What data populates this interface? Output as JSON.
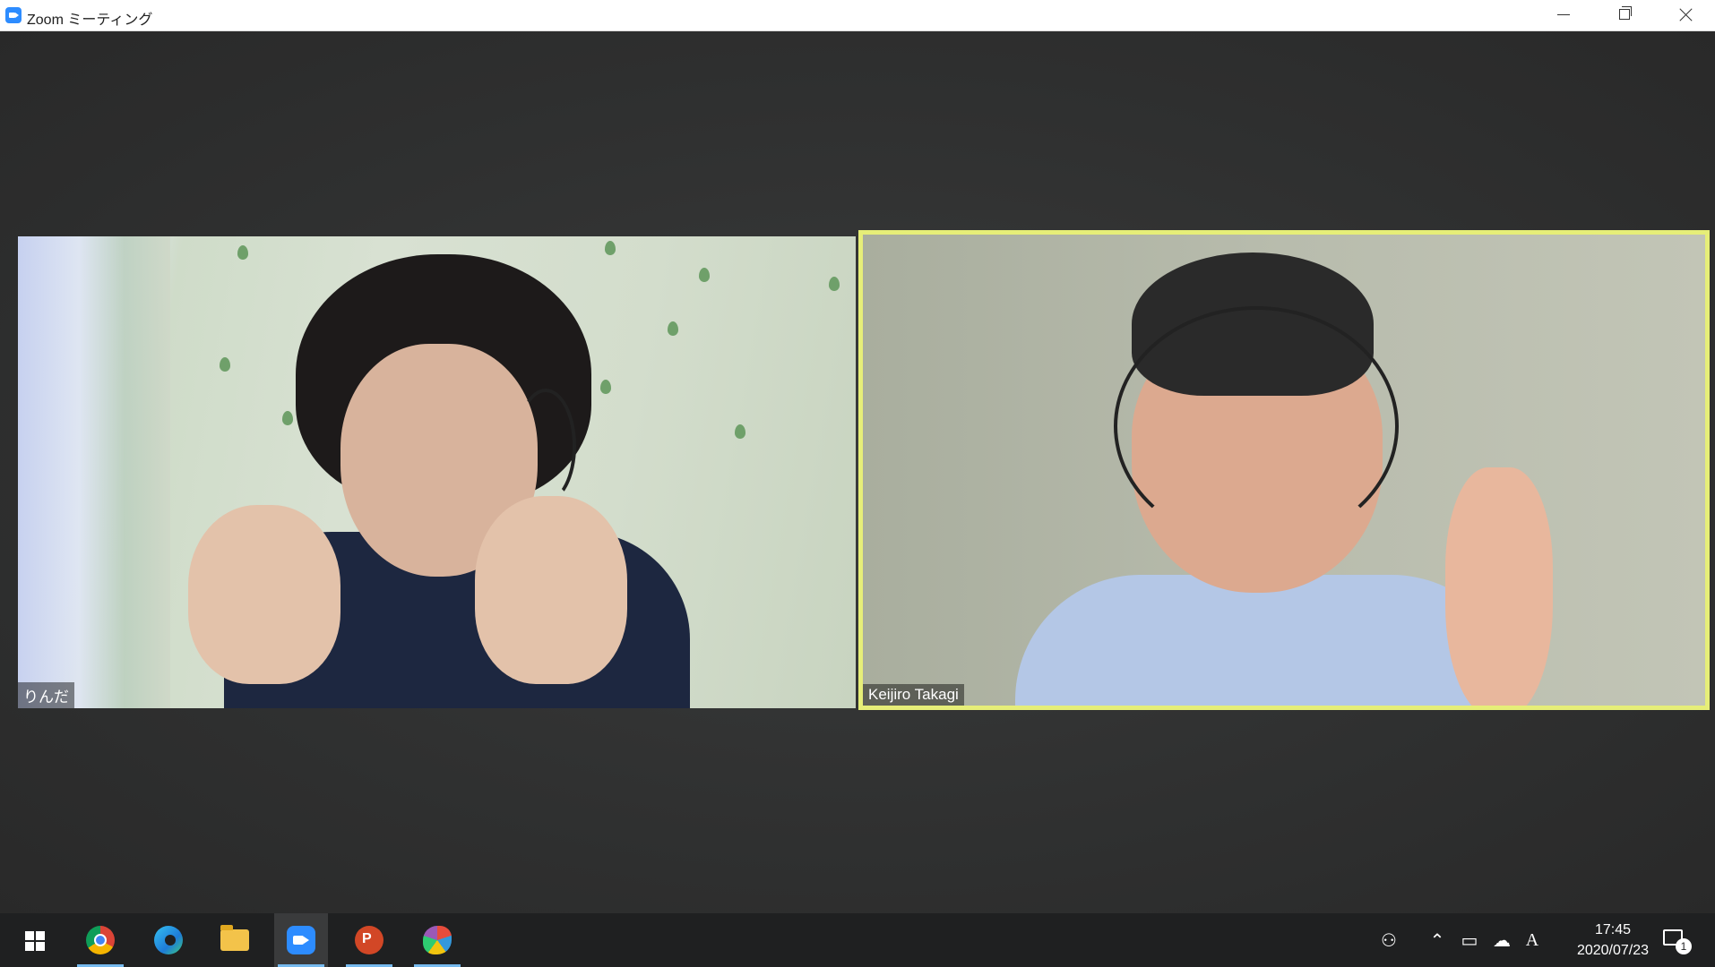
{
  "window": {
    "title": "Zoom ミーティング"
  },
  "participants": [
    {
      "name": "りんだ",
      "active_speaker": false
    },
    {
      "name": "Keijiro Takagi",
      "active_speaker": true
    }
  ],
  "colors": {
    "active_speaker_border": "#e6ee78",
    "zoom_blue": "#2d8cff",
    "taskbar": "#1f2021"
  },
  "taskbar": {
    "apps": [
      {
        "icon": "windows-start-icon",
        "active": false
      },
      {
        "icon": "chrome-icon",
        "active": false
      },
      {
        "icon": "edge-icon",
        "active": false
      },
      {
        "icon": "file-explorer-icon",
        "active": false
      },
      {
        "icon": "zoom-icon",
        "active": true
      },
      {
        "icon": "powerpoint-icon",
        "active": false
      },
      {
        "icon": "paint-icon",
        "active": false
      }
    ],
    "ppt_letter": "P",
    "ime_indicator": "A",
    "clock": {
      "time": "17:45",
      "date": "2020/07/23"
    },
    "notification_count": "1"
  }
}
